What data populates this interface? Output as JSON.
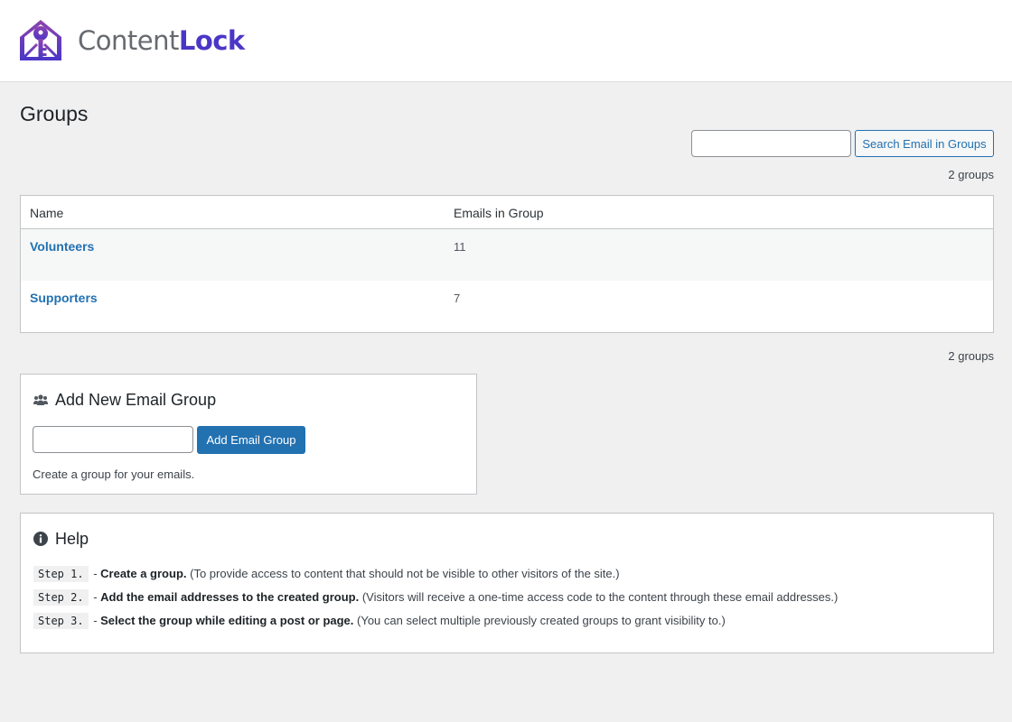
{
  "header": {
    "logo_text_1": "Content",
    "logo_text_2": "Lock",
    "brand_colors": {
      "primary": "#7b3fb6",
      "secondary": "#4a36c6"
    }
  },
  "page": {
    "title": "Groups",
    "search": {
      "value": "",
      "placeholder": "",
      "button_label": "Search Email in Groups"
    },
    "count_label": "2 groups"
  },
  "table": {
    "columns": [
      "Name",
      "Emails in Group"
    ],
    "rows": [
      {
        "name": "Volunteers",
        "emails": "11"
      },
      {
        "name": "Supporters",
        "emails": "7"
      }
    ]
  },
  "add_group": {
    "title": "Add New Email Group",
    "input_value": "",
    "button_label": "Add Email Group",
    "description": "Create a group for your emails.",
    "icon": "groups-icon"
  },
  "help": {
    "title": "Help",
    "icon": "info-icon",
    "steps": [
      {
        "code": "Step 1.",
        "bold": "Create a group.",
        "note": " (To provide access to content that should not be visible to other visitors of the site.)"
      },
      {
        "code": "Step 2.",
        "bold": "Add the email addresses to the created group.",
        "note": " (Visitors will receive a one-time access code to the content through these email addresses.)"
      },
      {
        "code": "Step 3.",
        "bold": "Select the group while editing a post or page.",
        "note": " (You can select multiple previously created groups to grant visibility to.)"
      }
    ]
  }
}
